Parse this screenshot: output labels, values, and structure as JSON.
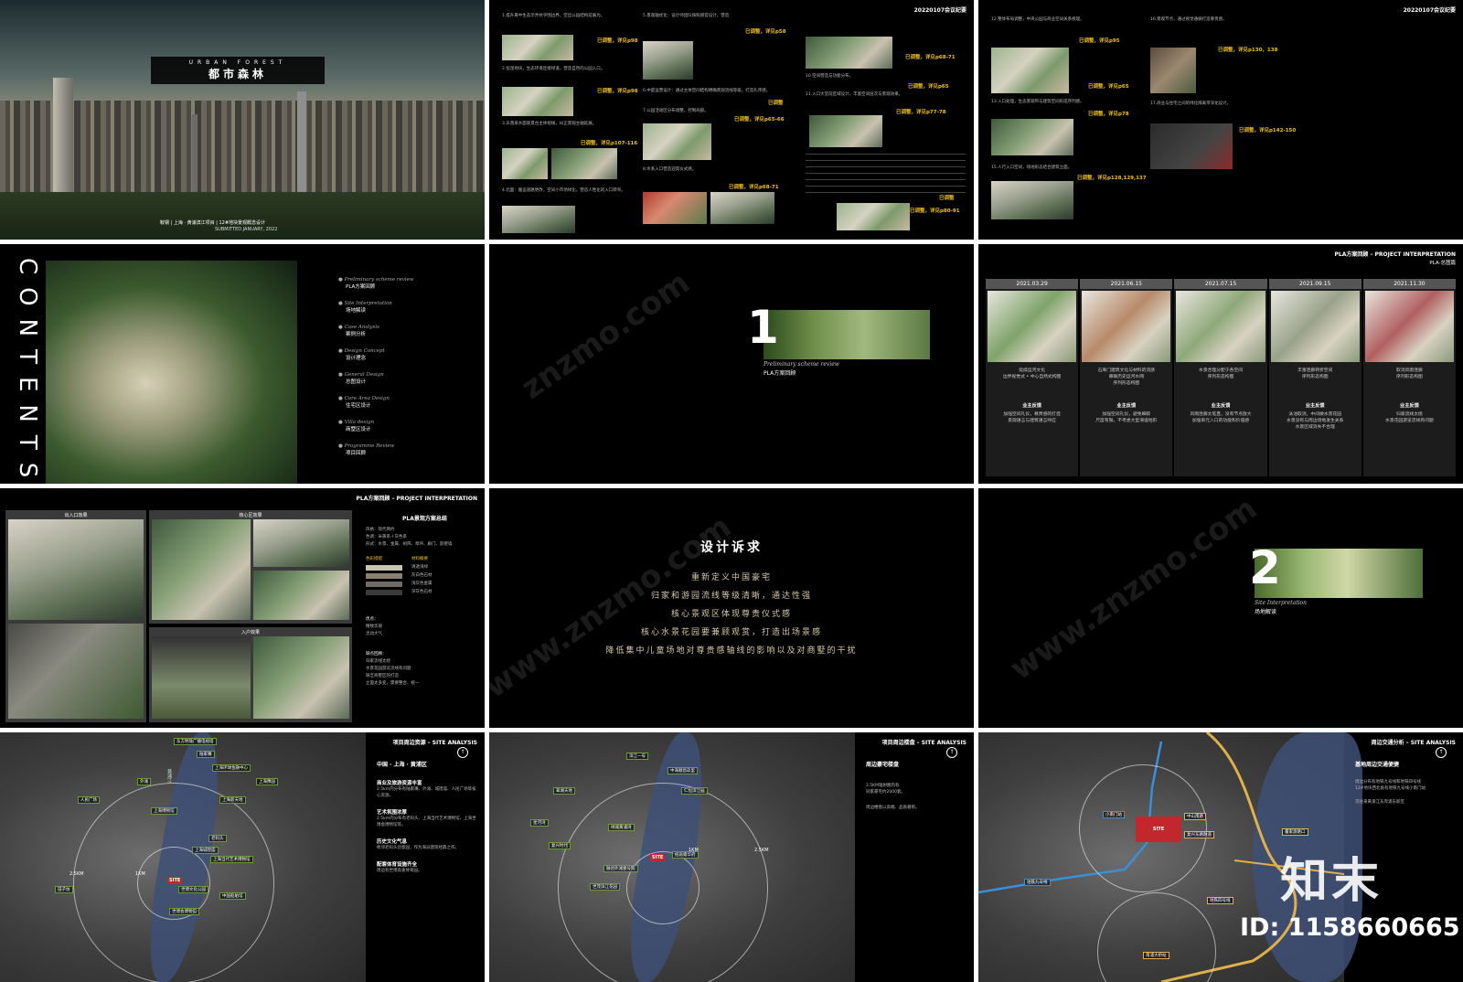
{
  "s1": {
    "title_en": "URBAN FOREST",
    "title_cn": "都市森林",
    "subtitle": "鞍钢 | 上海 · 黄浦滨江项目 | 12#地块景观概念设计",
    "submitted": "SUBMITTED  JANUARY, 2022"
  },
  "s2": {
    "p1": "1.提升黄中生态示弄纹乎围边界，空出公园结构延展为。",
    "p1_tag": "已调整，详见p98",
    "p2": "2.恒湿地块，生态环境连接绿道，营造自然的公园入口。",
    "p2_tag": "已调整，详见p98",
    "p3": "3.天落泉水面观景台主体视线，纠正景观主轴延展。",
    "p3_tag": "已调整，详见p107-116",
    "p4": "4.北面：搬运道路更改，空间小市场绿化，营造人性化的入口转弯。",
    "p5": "5.景观轴优化：设计师团队按照感官设计，营造",
    "p5_tag": "已调整，详见p58",
    "p6": "6.中庭运营设计：通过主体空间结构明确景观流线等级，打造礼序感。",
    "p6_tag": "已调整",
    "p7": "7.公园活动区分布调整，控制局部。",
    "p7_tag": "已调整，详见p65-66",
    "p8": "8.水系入口营造迎宾仪式感。",
    "p8_tag": "已调整，详见p68-71",
    "p9": "9.南侧园区界面新规划。",
    "p9_tag": "已调整，详见p68-71",
    "p10": "10.空间营造与功能分布。",
    "p10_tag": "已调整，详见p65",
    "p11": "11.入口大堂前区域设计，丰富空间层次与景观效果。",
    "p11_tag": "已调整，详见p77-78",
    "p11b_tag": "已调整",
    "p11c_tag": "已调整，详见p80-91"
  },
  "s3": {
    "header": "20220107会议纪要",
    "p12": "12.整体布局调整，中央公园与商业空间关系梳理。",
    "p12_tag": "已调整，详见p95",
    "p13": "13.入口处理，生态景观带与建筑空间形成序列感。",
    "p13_tag": "已调整，详见p65",
    "p14": "14.水景区域设计深化。",
    "p14_tag": "已调整，详见p78",
    "p15": "15.人行入口空间，场地形态结合建筑立面。",
    "p15_tag": "已调整，详见p128,129,137",
    "p16": "16.景观节点，通过视觉通廊打造尊贵感。",
    "p16_tag": "已调整，详见p130，138",
    "p17": "17.商业与住宅之间的绿化隔离带深化设计。",
    "p17_tag": "已调整，详见p142-150"
  },
  "s4": {
    "contents": "CONTENTS",
    "mulu": "目录",
    "items": [
      {
        "en": "Preliminary scheme review",
        "cn": "PLA方案回顾"
      },
      {
        "en": "Site Interpretation",
        "cn": "场地解读"
      },
      {
        "en": "Case Analysis",
        "cn": "案例分析"
      },
      {
        "en": "Design Concept",
        "cn": "设计理念"
      },
      {
        "en": "General Design",
        "cn": "总图设计"
      },
      {
        "en": "Core Area Design",
        "cn": "住宅区设计"
      },
      {
        "en": "Villa design",
        "cn": "商墅区设计"
      },
      {
        "en": "Programme Review",
        "cn": "项目回顾"
      }
    ]
  },
  "s5": {
    "num": "1",
    "en": "Preliminary scheme review",
    "cn": "PLA方案回顾"
  },
  "s6": {
    "header": "PLA方案回顾 – PROJECT INTERPRETATION",
    "sub": "PLA-总图篇",
    "cols": [
      {
        "date": "2021.03.29",
        "desc": "延续运河文化\n边界视觉式 • 中心自然式构图",
        "fb_title": "业主反馈",
        "fb": "加强空间礼仪，尊贵感的打造\n景观语言与建筑语言呼应"
      },
      {
        "date": "2021.06.15",
        "desc": "石库门建筑文化与材料的流感\n串联历史运河水网\n序列形态构图",
        "fb_title": "业主反馈",
        "fb": "加强空间礼仪，避免细碎\n尺度有限，不考虑大型滑道地形"
      },
      {
        "date": "2021.07.15",
        "desc": "水景合理分配于各空间\n序列形态构图",
        "fb_title": "业主反馈",
        "fb": "风雨连廊太笔直，没有节点放大\n加强单元入口的功能和价值感"
      },
      {
        "date": "2021.09.15",
        "desc": "丰富连廊转折空间\n序列形态构图",
        "fb_title": "业主反馈",
        "fb": "泳池取消，中间做水景花园\n水景没有与周边场地发生关系\n水景区域消失不合理"
      },
      {
        "date": "2021.11.30",
        "desc": "取消风雨连廊\n序列形态构图",
        "fb_title": "业主反馈",
        "fb": "归家流线太绕\n水景花园游览流线有问题"
      }
    ]
  },
  "s7": {
    "header": "PLA方案回顾 – PROJECT INTERPRETATION",
    "title": "PLA景观方案总结",
    "l1": "出入口效果",
    "l2": "核心区效果",
    "l3": "入户效果",
    "style": "风格：现代简约",
    "color": "色调：米黄系＋灰色系",
    "form": "形式：水景、金属、树阵、草坪、廊门、影壁墙",
    "mat_title": "色彩搭配",
    "mat_title2": "材料概要",
    "mats": [
      "清透浅绿",
      "灰白色石材",
      "浅灰色金属",
      "深灰色石材"
    ],
    "adv_title": "优点：",
    "advs": [
      "精致华丽",
      "灵动大气"
    ],
    "dis_title": "缺点回顾：",
    "diss": [
      "归家流线太绕",
      "水景花园游览流线有问题",
      "缺乏商墅区的打造",
      "立面太多变，需要整合、统一"
    ]
  },
  "s8": {
    "title": "设计诉求",
    "lines": [
      "重新定义中国豪宅",
      "归家和游园流线等级清晰，通达性强",
      "核心景观区体现尊贵仪式感",
      "核心水景花园要兼顾观赏，打造出场景感",
      "降低集中儿童场地对尊贵感轴线的影响以及对商墅的干扰"
    ]
  },
  "s9": {
    "num": "2",
    "en": "Site Interpretation",
    "cn": "场地解读"
  },
  "s10": {
    "header": "项目周边资源 – SITE ANALYSIS",
    "loc": "中国 · 上海 · 黄浦区",
    "h1": "商业及旅游资源丰富",
    "t1": "2.5km内分布有陆家嘴、外滩、城隍庙、人民广场等核心资源。",
    "h2": "艺术氛围浓厚",
    "t2": "2.5km内分布有老码头、上海当代艺术博物馆、上海世博会博物馆等。",
    "h3": "历史文化气息",
    "t3": "毗邻老码头创意园，作为海派建筑经典之作。",
    "h4": "配套体育设施齐全",
    "t4": "周边有世博高速体育园。",
    "site": "SITE",
    "r1": "1KM",
    "r2": "2.5KM",
    "pins": [
      "东方明珠广播电视塔",
      "陆家嘴",
      "上海环球金融中心",
      "外滩",
      "人民广场",
      "上海博物馆",
      "上海新天地",
      "上海豫园",
      "老码头",
      "上海城隍庙",
      "上海当代艺术博物馆",
      "世博文化公园",
      "中国船舶馆",
      "世博会博物馆",
      "田子坊"
    ],
    "river": "黄浦江"
  },
  "s11": {
    "header": "项目周边楼盘 – SITE ANALYSIS",
    "title": "周边豪宅楼盘",
    "t1": "2.5KM辐射圈内有",
    "t2": "同家豪宅约2000套。",
    "t3": "周边楼盘以高端、品质著称。",
    "site": "SITE",
    "r1": "1KM",
    "r2": "2.5KM",
    "pins": [
      "滨江一号",
      "中海顺昌玖里",
      "翠湖天地",
      "星河湾",
      "仁恒滨江园",
      "绿城黄浦湾",
      "复兴时代",
      "融创外滩壹号院",
      "招商雍华府",
      "世茂滨江花园"
    ]
  },
  "s12": {
    "header": "周边交通分析 – SITE ANALYSIS",
    "title": "基地周边交通便捷",
    "t1": "周边分布有地铁九号线和地铁四号线",
    "t2": "12#地块西北角有地铁九号线小南门站",
    "t3": "可往来黄浦江东岸浦东新区",
    "site": "SITE",
    "st1": "小南门站",
    "st2": "董家渡路口",
    "st3": "南浦大桥站",
    "road1": "中山南路",
    "road2": "复兴东路隧道",
    "road3": "地铁九号线",
    "road4": "地铁四号线",
    "wm": "知末",
    "id": "ID: 1158660665"
  }
}
